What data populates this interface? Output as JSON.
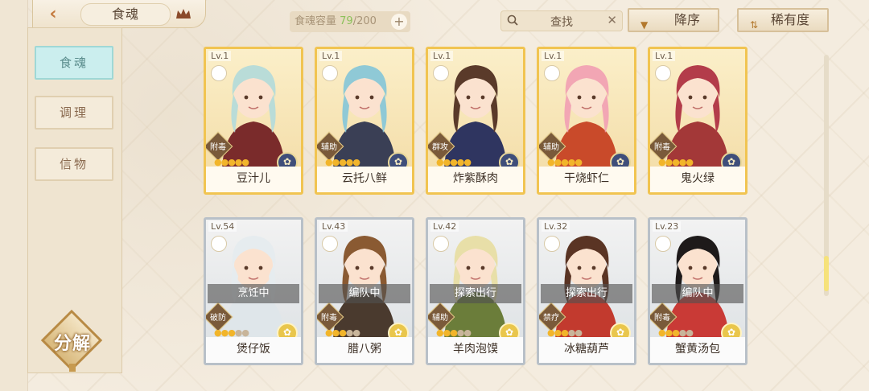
{
  "header": {
    "title": "食魂",
    "capacity_label": "食魂容量",
    "capacity_current": "79",
    "capacity_total": "/200",
    "search_label": "查找",
    "sort_desc_label": "降序",
    "sort_rarity_label": "稀有度"
  },
  "sidebar": {
    "tabs": [
      {
        "label": "食魂"
      },
      {
        "label": "调理"
      },
      {
        "label": "信物"
      }
    ],
    "decompose_label": "分解"
  },
  "cards": [
    {
      "level": "Lv.1",
      "name": "豆汁儿",
      "role": "附毒",
      "status": "",
      "stars_lit": 5,
      "frame": "gold",
      "hair": "#b9dcd8",
      "outfit": "#7a2b2b",
      "accent": "#3f4e7a"
    },
    {
      "level": "Lv.1",
      "name": "云托八鲜",
      "role": "辅助",
      "status": "",
      "stars_lit": 5,
      "frame": "gold",
      "hair": "#8fc9d6",
      "outfit": "#3a3f55",
      "accent": "#3f4e7a"
    },
    {
      "level": "Lv.1",
      "name": "炸紫酥肉",
      "role": "群攻",
      "status": "",
      "stars_lit": 5,
      "frame": "gold",
      "hair": "#5a3a2a",
      "outfit": "#2f3560",
      "accent": "#3f4e7a"
    },
    {
      "level": "Lv.1",
      "name": "干烧虾仁",
      "role": "辅助",
      "status": "",
      "stars_lit": 5,
      "frame": "gold",
      "hair": "#f2a6b4",
      "outfit": "#c94a2a",
      "accent": "#3f4e7a"
    },
    {
      "level": "Lv.1",
      "name": "鬼火绿",
      "role": "附毒",
      "status": "",
      "stars_lit": 5,
      "frame": "gold",
      "hair": "#b33c4a",
      "outfit": "#a33838",
      "accent": "#3f4e7a"
    },
    {
      "level": "Lv.54",
      "name": "煲仔饭",
      "role": "破防",
      "status": "烹饪中",
      "stars_lit": 3,
      "frame": "silver",
      "hair": "#e6ecef",
      "outfit": "#dfe6ea",
      "accent": "#e9c64c"
    },
    {
      "level": "Lv.43",
      "name": "腊八粥",
      "role": "附毒",
      "status": "编队中",
      "stars_lit": 3,
      "frame": "silver",
      "hair": "#8a5a32",
      "outfit": "#4a3a2e",
      "accent": "#e9c64c"
    },
    {
      "level": "Lv.42",
      "name": "羊肉泡馍",
      "role": "辅助",
      "status": "探索出行",
      "stars_lit": 3,
      "frame": "silver",
      "hair": "#e8dfa8",
      "outfit": "#6b7d3a",
      "accent": "#e9c64c"
    },
    {
      "level": "Lv.32",
      "name": "冰糖葫芦",
      "role": "禁疗",
      "status": "探索出行",
      "stars_lit": 3,
      "frame": "silver",
      "hair": "#5a3424",
      "outfit": "#c23a2e",
      "accent": "#e9c64c"
    },
    {
      "level": "Lv.23",
      "name": "蟹黄汤包",
      "role": "附毒",
      "status": "编队中",
      "stars_lit": 3,
      "frame": "silver",
      "hair": "#1e1a1a",
      "outfit": "#c93a36",
      "accent": "#e9c64c"
    }
  ]
}
